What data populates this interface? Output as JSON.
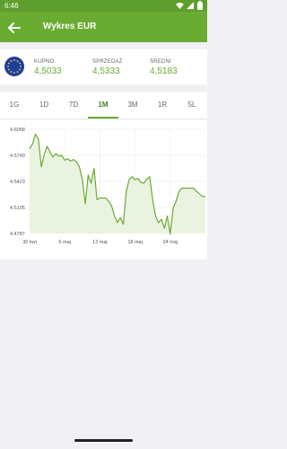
{
  "status_bar": {
    "time": "6:46"
  },
  "app_bar": {
    "title": "Wykres EUR"
  },
  "rates": [
    {
      "label": "KUPNO",
      "value": "4,5033"
    },
    {
      "label": "SPRZEDAŻ",
      "value": "4,5333"
    },
    {
      "label": "ŚREDNI",
      "value": "4,5183"
    }
  ],
  "tabs": [
    "1G",
    "1D",
    "7D",
    "1M",
    "3M",
    "1R",
    "5L"
  ],
  "active_tab": "1M",
  "colors": {
    "accent": "#6aab31",
    "status_bar": "#5e9e2c",
    "line": "#6aab31",
    "area": "#eaf3e0"
  },
  "chart_data": {
    "type": "area",
    "y_ticks": [
      "4.6058",
      "4.5740",
      "4.5423",
      "4.5105",
      "4.4787"
    ],
    "x_ticks": [
      {
        "label": "30 kwi",
        "x": 0
      },
      {
        "label": "6 maj",
        "x": 6
      },
      {
        "label": "12 maj",
        "x": 12
      },
      {
        "label": "18 maj",
        "x": 18
      },
      {
        "label": "24 maj",
        "x": 24
      }
    ],
    "xlim": [
      0,
      30
    ],
    "ylim": [
      4.4787,
      4.6058
    ],
    "grid": true,
    "series": [
      {
        "x": [
          0,
          0.5,
          1,
          1.5,
          2,
          2.5,
          3,
          3.5,
          4,
          4.5,
          5,
          5.5,
          6,
          6.5,
          7,
          7.5,
          8,
          8.5,
          9,
          9.5,
          10,
          10.5,
          11,
          11.5,
          12,
          12.5,
          13,
          13.5,
          14,
          14.5,
          15,
          15.5,
          16,
          16.5,
          17,
          17.5,
          18,
          18.5,
          19,
          19.5,
          20,
          20.5,
          21,
          21.5,
          22,
          22.5,
          23,
          23.5,
          24,
          24.5,
          25,
          25.5,
          26,
          26.5,
          27,
          27.5,
          28,
          28.5,
          29,
          29.5,
          30
        ],
        "y": [
          4.582,
          4.588,
          4.6,
          4.594,
          4.56,
          4.575,
          4.585,
          4.578,
          4.572,
          4.576,
          4.573,
          4.574,
          4.568,
          4.57,
          4.567,
          4.569,
          4.566,
          4.56,
          4.545,
          4.515,
          4.55,
          4.54,
          4.558,
          4.52,
          4.522,
          4.522,
          4.522,
          4.518,
          4.512,
          4.5,
          4.492,
          4.498,
          4.49,
          4.53,
          4.545,
          4.548,
          4.544,
          4.546,
          4.541,
          4.54,
          4.545,
          4.548,
          4.52,
          4.5,
          4.492,
          4.496,
          4.485,
          4.5,
          4.478,
          4.51,
          4.518,
          4.53,
          4.534,
          4.534,
          4.534,
          4.534,
          4.534,
          4.53,
          4.527,
          4.524,
          4.524
        ]
      }
    ]
  }
}
